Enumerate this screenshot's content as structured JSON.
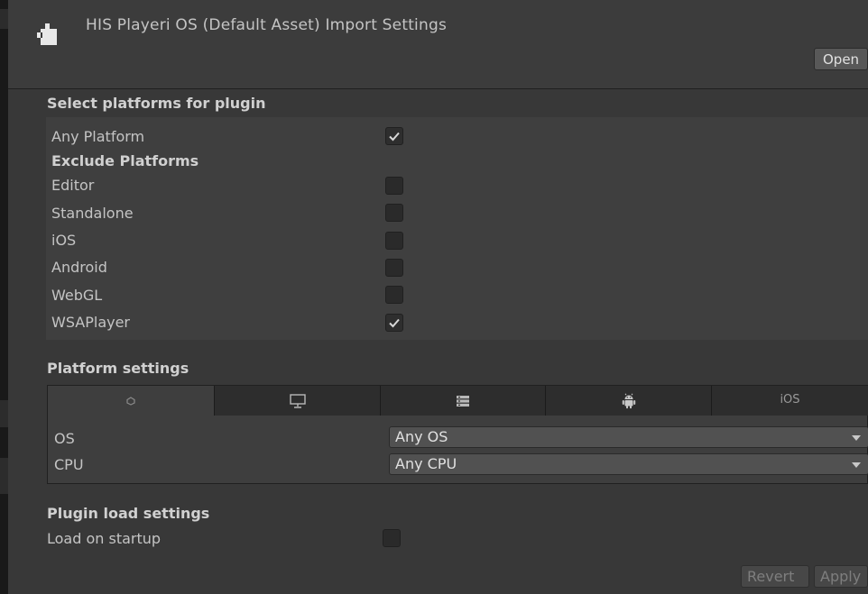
{
  "header": {
    "title": "HIS Playeri OS (Default Asset) Import Settings",
    "open_label": "Open"
  },
  "select_platforms": {
    "title": "Select platforms for plugin",
    "any_platform": {
      "label": "Any Platform",
      "checked": true
    },
    "exclude_title": "Exclude Platforms",
    "platforms": [
      {
        "label": "Editor",
        "checked": false
      },
      {
        "label": "Standalone",
        "checked": false
      },
      {
        "label": "iOS",
        "checked": false
      },
      {
        "label": "Android",
        "checked": false
      },
      {
        "label": "WebGL",
        "checked": false
      },
      {
        "label": "WSAPlayer",
        "checked": true
      }
    ]
  },
  "platform_settings": {
    "title": "Platform settings",
    "tabs": [
      {
        "icon": "unity-icon",
        "text": "",
        "active": true
      },
      {
        "icon": "monitor-icon",
        "text": "",
        "active": false
      },
      {
        "icon": "server-icon",
        "text": "",
        "active": false
      },
      {
        "icon": "android-icon",
        "text": "",
        "active": false
      },
      {
        "icon": "",
        "text": "iOS",
        "active": false
      }
    ],
    "os": {
      "label": "OS",
      "value": "Any OS"
    },
    "cpu": {
      "label": "CPU",
      "value": "Any CPU"
    }
  },
  "plugin_load": {
    "title": "Plugin load settings",
    "load_on_startup": {
      "label": "Load on startup",
      "checked": false
    }
  },
  "footer": {
    "revert_label": "Revert",
    "apply_label": "Apply"
  },
  "colors": {
    "background": "#383838",
    "checkmark": "#d8d8d8",
    "text": "#c4c4c4"
  }
}
